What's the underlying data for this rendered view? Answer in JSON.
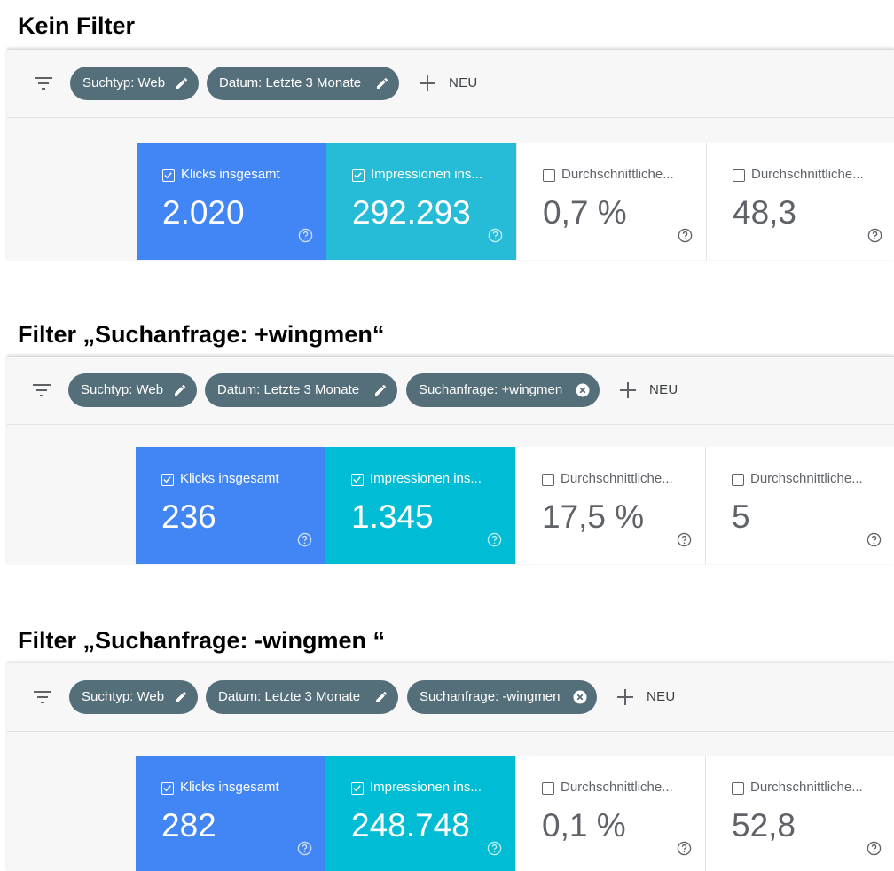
{
  "new_label": "NEU",
  "panels": [
    {
      "title": "Kein Filter",
      "chips": [
        "Suchtyp: Web",
        "Datum: Letzte 3 Monate"
      ],
      "metrics": [
        {
          "label": "Klicks insgesamt",
          "value": "2.020",
          "checked": true,
          "color": "#4285f4"
        },
        {
          "label": "Impressionen ins...",
          "value": "292.293",
          "checked": true,
          "color": "#26bcd7"
        },
        {
          "label": "Durchschnittliche...",
          "value": "0,7 %",
          "checked": false
        },
        {
          "label": "Durchschnittliche...",
          "value": "48,3",
          "checked": false
        }
      ]
    },
    {
      "title": "Filter „Suchanfrage: +wingmen“",
      "chips": [
        "Suchtyp: Web",
        "Datum: Letzte 3 Monate",
        "Suchanfrage: +wingmen"
      ],
      "metrics": [
        {
          "label": "Klicks insgesamt",
          "value": "236",
          "checked": true,
          "color": "#4285f4"
        },
        {
          "label": "Impressionen ins...",
          "value": "1.345",
          "checked": true,
          "color": "#00bcd4"
        },
        {
          "label": "Durchschnittliche...",
          "value": "17,5 %",
          "checked": false
        },
        {
          "label": "Durchschnittliche...",
          "value": "5",
          "checked": false
        }
      ]
    },
    {
      "title": "Filter „Suchanfrage: -wingmen “",
      "chips": [
        "Suchtyp: Web",
        "Datum: Letzte 3 Monate",
        "Suchanfrage: -wingmen"
      ],
      "metrics": [
        {
          "label": "Klicks insgesamt",
          "value": "282",
          "checked": true,
          "color": "#4285f4"
        },
        {
          "label": "Impressionen ins...",
          "value": "248.748",
          "checked": true,
          "color": "#00bcd4"
        },
        {
          "label": "Durchschnittliche...",
          "value": "0,1 %",
          "checked": false
        },
        {
          "label": "Durchschnittliche...",
          "value": "52,8",
          "checked": false
        }
      ]
    }
  ]
}
